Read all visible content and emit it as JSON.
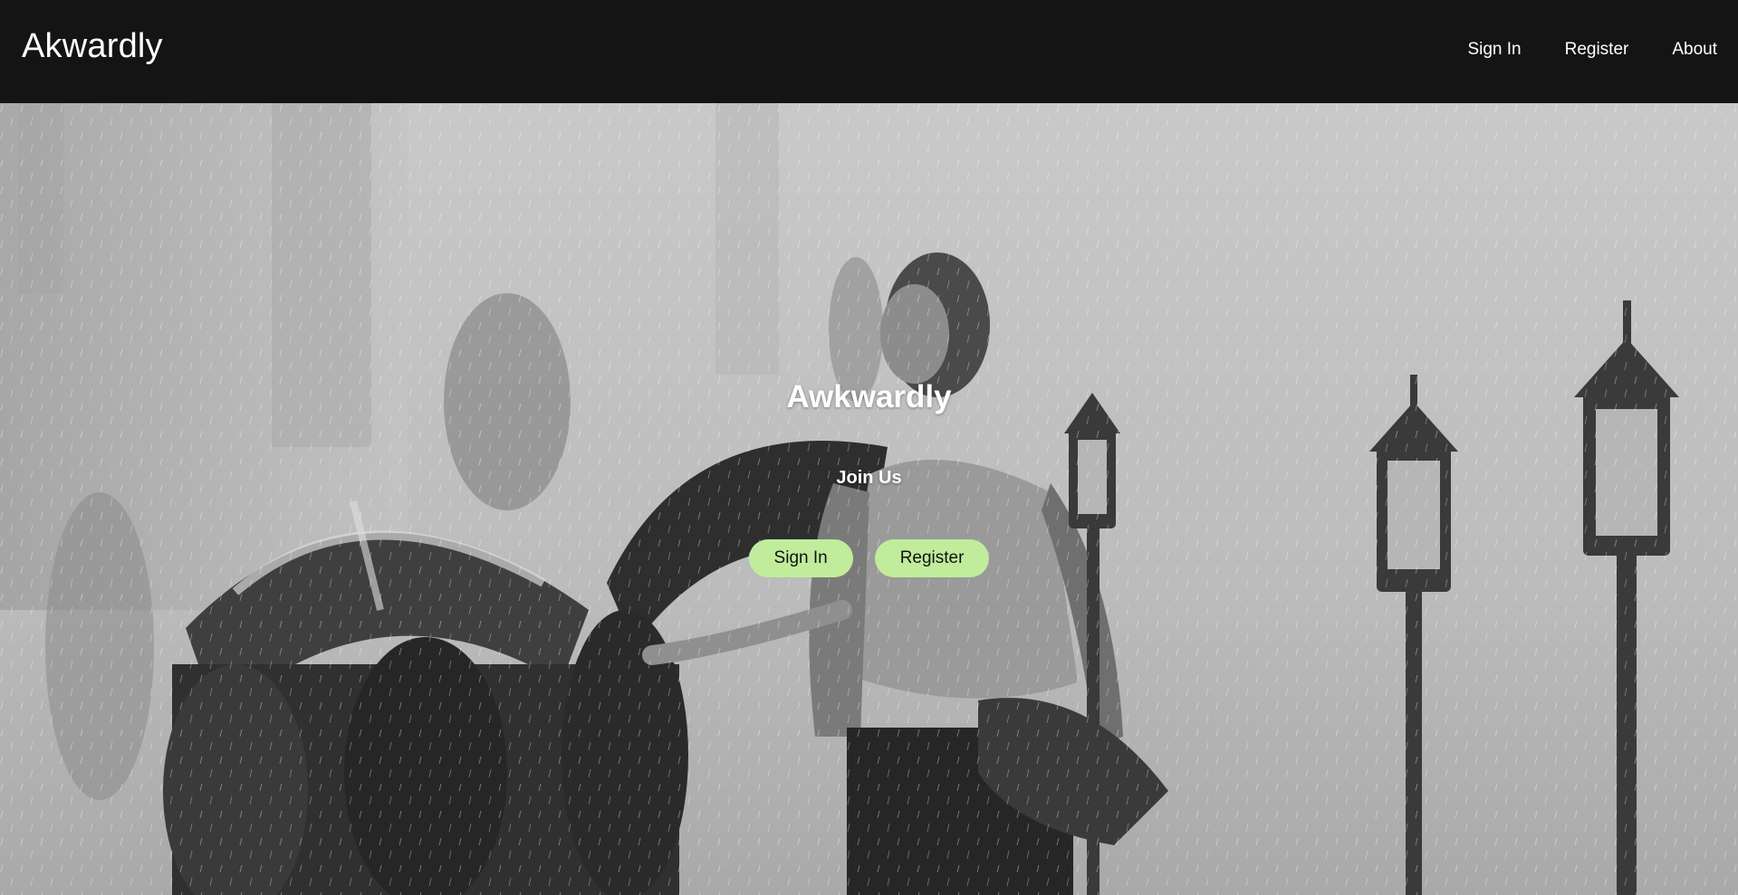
{
  "navbar": {
    "brand": "Akwardly",
    "links": [
      "Sign In",
      "Register",
      "About"
    ]
  },
  "hero": {
    "title": "Awkwardly",
    "subtitle": "Join Us",
    "buttons": {
      "signin": "Sign In",
      "register": "Register"
    },
    "image": "rainy-street-photo"
  },
  "colors": {
    "navbar_bg": "#141414",
    "button_bg": "#c0ec9c",
    "text": "#ffffff"
  }
}
